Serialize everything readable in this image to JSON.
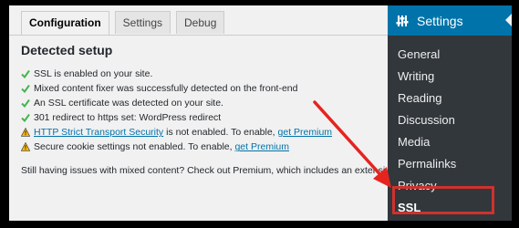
{
  "tabs": [
    {
      "label": "Configuration",
      "active": true
    },
    {
      "label": "Settings",
      "active": false
    },
    {
      "label": "Debug",
      "active": false
    }
  ],
  "heading": "Detected setup",
  "checks": [
    {
      "icon": "check-icon",
      "text": "SSL is enabled on your site."
    },
    {
      "icon": "check-icon",
      "text": "Mixed content fixer was successfully detected on the front-end"
    },
    {
      "icon": "check-icon",
      "text": "An SSL certificate was detected on your site."
    },
    {
      "icon": "check-icon",
      "text": "301 redirect to https set: WordPress redirect"
    },
    {
      "icon": "warning-icon",
      "link": "HTTP Strict Transport Security",
      "text": " is not enabled. To enable, ",
      "link2": "get Premium"
    },
    {
      "icon": "warning-icon",
      "text": "Secure cookie settings not enabled. To enable, ",
      "link2": "get Premium"
    }
  ],
  "footer": "Still having issues with mixed content? Check out Premium, which includes an extensive scan and",
  "menu": {
    "title": "Settings",
    "items": [
      "General",
      "Writing",
      "Reading",
      "Discussion",
      "Media",
      "Permalinks",
      "Privacy",
      "SSL"
    ]
  },
  "colors": {
    "check": "#46b450",
    "warning": "#ffb900",
    "highlight": "#d0312d",
    "menu_bg": "#32373c",
    "menu_head": "#0073aa"
  }
}
